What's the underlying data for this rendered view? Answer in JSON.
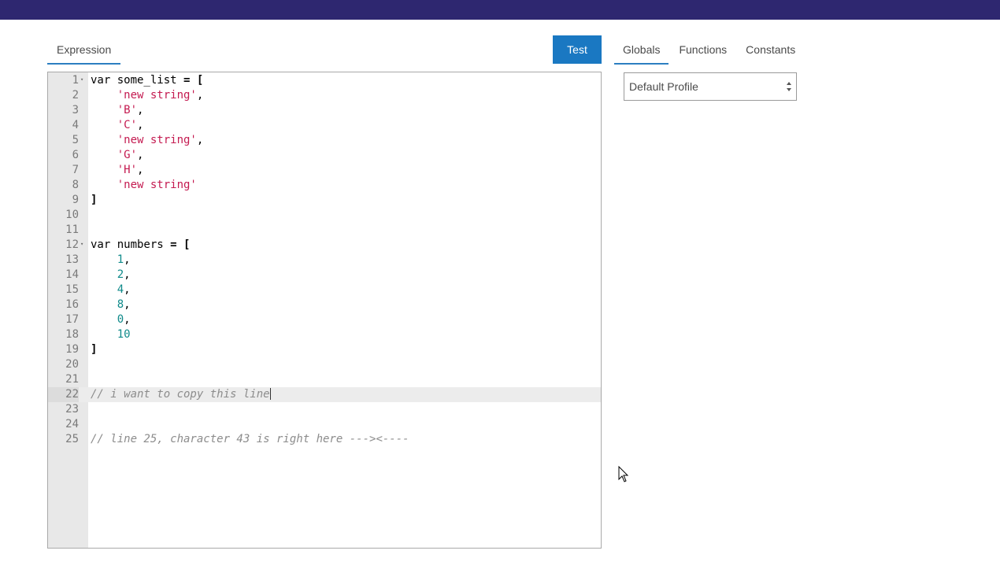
{
  "header": {
    "bar_color": "#2e2770"
  },
  "editor_tabs": [
    {
      "label": "Expression",
      "active": true
    }
  ],
  "test_button": {
    "label": "Test"
  },
  "side_tabs": [
    {
      "label": "Globals",
      "active": true
    },
    {
      "label": "Functions",
      "active": false
    },
    {
      "label": "Constants",
      "active": false
    }
  ],
  "profile_select": {
    "value": "Default Profile"
  },
  "colors": {
    "accent": "#1a78c2",
    "string": "#c41a50",
    "number": "#0f8a8a",
    "comment": "#8c8c8c"
  },
  "editor": {
    "active_line": 22,
    "lines": [
      {
        "n": "1",
        "fold": true,
        "tokens": [
          {
            "t": "kw",
            "v": "var some_list "
          },
          {
            "t": "bold",
            "v": "= ["
          }
        ]
      },
      {
        "n": "2",
        "tokens": [
          {
            "t": "pl",
            "v": "    "
          },
          {
            "t": "str",
            "v": "'new string'"
          },
          {
            "t": "pl",
            "v": ","
          }
        ]
      },
      {
        "n": "3",
        "tokens": [
          {
            "t": "pl",
            "v": "    "
          },
          {
            "t": "str",
            "v": "'B'"
          },
          {
            "t": "pl",
            "v": ","
          }
        ]
      },
      {
        "n": "4",
        "tokens": [
          {
            "t": "pl",
            "v": "    "
          },
          {
            "t": "str",
            "v": "'C'"
          },
          {
            "t": "pl",
            "v": ","
          }
        ]
      },
      {
        "n": "5",
        "tokens": [
          {
            "t": "pl",
            "v": "    "
          },
          {
            "t": "str",
            "v": "'new string'"
          },
          {
            "t": "pl",
            "v": ","
          }
        ]
      },
      {
        "n": "6",
        "tokens": [
          {
            "t": "pl",
            "v": "    "
          },
          {
            "t": "str",
            "v": "'G'"
          },
          {
            "t": "pl",
            "v": ","
          }
        ]
      },
      {
        "n": "7",
        "tokens": [
          {
            "t": "pl",
            "v": "    "
          },
          {
            "t": "str",
            "v": "'H'"
          },
          {
            "t": "pl",
            "v": ","
          }
        ]
      },
      {
        "n": "8",
        "tokens": [
          {
            "t": "pl",
            "v": "    "
          },
          {
            "t": "str",
            "v": "'new string'"
          }
        ]
      },
      {
        "n": "9",
        "tokens": [
          {
            "t": "bold",
            "v": "]"
          }
        ]
      },
      {
        "n": "10",
        "tokens": []
      },
      {
        "n": "11",
        "tokens": []
      },
      {
        "n": "12",
        "fold": true,
        "tokens": [
          {
            "t": "kw",
            "v": "var numbers "
          },
          {
            "t": "bold",
            "v": "= ["
          }
        ]
      },
      {
        "n": "13",
        "tokens": [
          {
            "t": "pl",
            "v": "    "
          },
          {
            "t": "num",
            "v": "1"
          },
          {
            "t": "pl",
            "v": ","
          }
        ]
      },
      {
        "n": "14",
        "tokens": [
          {
            "t": "pl",
            "v": "    "
          },
          {
            "t": "num",
            "v": "2"
          },
          {
            "t": "pl",
            "v": ","
          }
        ]
      },
      {
        "n": "15",
        "tokens": [
          {
            "t": "pl",
            "v": "    "
          },
          {
            "t": "num",
            "v": "4"
          },
          {
            "t": "pl",
            "v": ","
          }
        ]
      },
      {
        "n": "16",
        "tokens": [
          {
            "t": "pl",
            "v": "    "
          },
          {
            "t": "num",
            "v": "8"
          },
          {
            "t": "pl",
            "v": ","
          }
        ]
      },
      {
        "n": "17",
        "tokens": [
          {
            "t": "pl",
            "v": "    "
          },
          {
            "t": "num",
            "v": "0"
          },
          {
            "t": "pl",
            "v": ","
          }
        ]
      },
      {
        "n": "18",
        "tokens": [
          {
            "t": "pl",
            "v": "    "
          },
          {
            "t": "num",
            "v": "10"
          }
        ]
      },
      {
        "n": "19",
        "tokens": [
          {
            "t": "bold",
            "v": "]"
          }
        ]
      },
      {
        "n": "20",
        "tokens": []
      },
      {
        "n": "21",
        "tokens": []
      },
      {
        "n": "22",
        "cursor": true,
        "tokens": [
          {
            "t": "cm",
            "v": "// i want to copy this line"
          }
        ]
      },
      {
        "n": "23",
        "tokens": []
      },
      {
        "n": "24",
        "tokens": []
      },
      {
        "n": "25",
        "tokens": [
          {
            "t": "cm",
            "v": "// line 25, character 43 is right here --->"
          },
          {
            "t": "cm",
            "v": "<----"
          }
        ]
      }
    ]
  }
}
